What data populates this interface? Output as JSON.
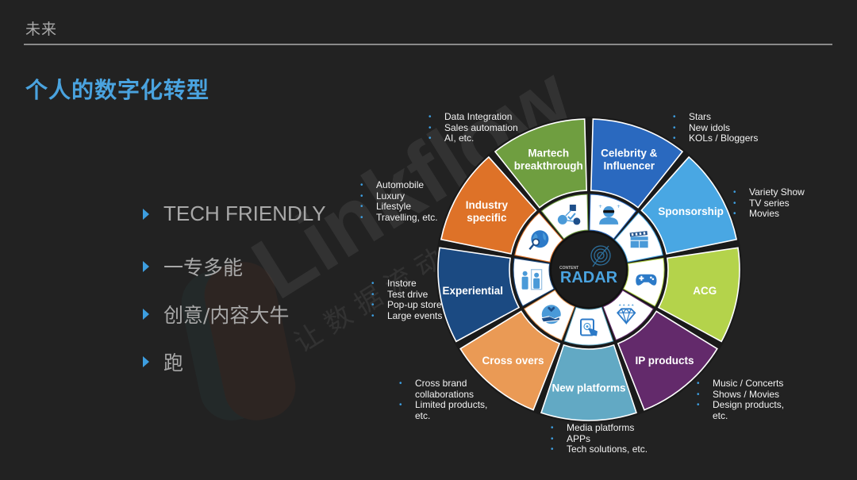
{
  "header": {
    "section_label": "未来",
    "title": "个人的数字化转型"
  },
  "bullets": [
    {
      "text": "TECH FRIENDLY"
    },
    {
      "text": "一专多能"
    },
    {
      "text": "创意/内容大牛"
    },
    {
      "text": "跑"
    }
  ],
  "radar": {
    "center_small": "CONTENT",
    "center_big": "RADAR",
    "segments": [
      {
        "label_lines": [
          "Celebrity &",
          "Influencer"
        ],
        "color": "#2a69bf",
        "icon": "sunglasses-person-icon"
      },
      {
        "label_lines": [
          "Sponsorship"
        ],
        "color": "#49a7e3",
        "icon": "clapperboard-icon"
      },
      {
        "label_lines": [
          "ACG"
        ],
        "color": "#b4d34b",
        "icon": "gamepad-icon"
      },
      {
        "label_lines": [
          "IP products"
        ],
        "color": "#632a6b",
        "icon": "diamond-icon"
      },
      {
        "label_lines": [
          "New platforms"
        ],
        "color": "#62a9c4",
        "icon": "tablet-touch-icon"
      },
      {
        "label_lines": [
          "Cross overs"
        ],
        "color": "#ea9a55",
        "icon": "handshake-icon"
      },
      {
        "label_lines": [
          "Experiential"
        ],
        "color": "#1b4a82",
        "icon": "people-icon"
      },
      {
        "label_lines": [
          "Industry",
          "specific"
        ],
        "color": "#de7228",
        "icon": "globe-search-icon"
      },
      {
        "label_lines": [
          "Martech",
          "breakthrough"
        ],
        "color": "#6f9e40",
        "icon": "network-check-icon"
      }
    ]
  },
  "notes": {
    "martech": [
      "Data Integration",
      "Sales automation",
      "AI, etc."
    ],
    "celebrity": [
      "Stars",
      "New idols",
      "KOLs / Bloggers"
    ],
    "sponsorship": [
      "Variety Show",
      "TV series",
      "Movies"
    ],
    "industry": [
      "Automobile",
      "Luxury",
      "Lifestyle",
      "Travelling, etc."
    ],
    "experiential": [
      "Instore",
      "Test drive",
      "Pop-up store",
      "Large events"
    ],
    "crossovers": [
      {
        "lines": [
          "Cross brand",
          "collaborations"
        ]
      },
      {
        "lines": [
          "Limited products,",
          "etc."
        ]
      }
    ],
    "newplatforms": [
      "Media platforms",
      "APPs",
      "Tech solutions, etc."
    ],
    "ipproducts": [
      {
        "lines": [
          "Music / Concerts"
        ]
      },
      {
        "lines": [
          "Shows / Movies"
        ]
      },
      {
        "lines": [
          "Design products,",
          "etc."
        ]
      }
    ]
  },
  "watermark": {
    "brand": "Linkflow",
    "slogan": "让数据流动起来"
  }
}
